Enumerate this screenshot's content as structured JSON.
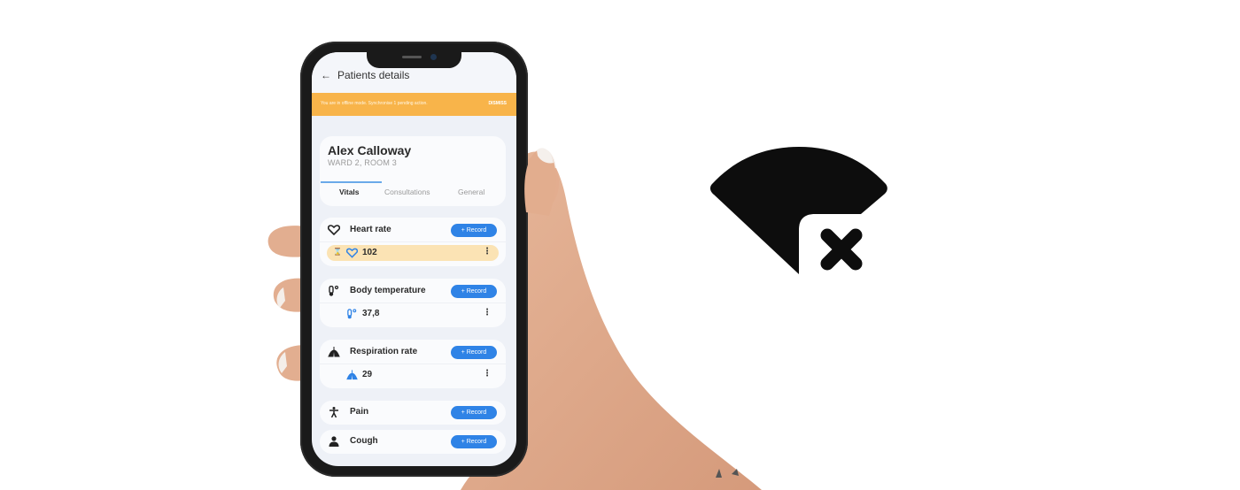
{
  "app": {
    "title": "Patients details",
    "back_icon": "arrow-left-icon"
  },
  "banner": {
    "message": "You are in offline mode. Synchronise 1 pending action.",
    "dismiss_label": "DISMISS",
    "color": "#f8b44a"
  },
  "patient": {
    "name": "Alex Calloway",
    "location": "WARD 2, ROOM 3"
  },
  "tabs": [
    {
      "label": "Vitals",
      "active": true
    },
    {
      "label": "Consultations",
      "active": false
    },
    {
      "label": "General",
      "active": false
    }
  ],
  "vitals": [
    {
      "label": "Heart rate",
      "icon": "heart-icon",
      "record_label": "+ Record",
      "value": "102",
      "value_icon": "heart-icon",
      "pending": true
    },
    {
      "label": "Body temperature",
      "icon": "thermometer-icon",
      "record_label": "+ Record",
      "value": "37,8",
      "value_icon": "thermometer-icon",
      "pending": false
    },
    {
      "label": "Respiration rate",
      "icon": "lungs-icon",
      "record_label": "+ Record",
      "value": "29",
      "value_icon": "lungs-icon",
      "pending": false
    },
    {
      "label": "Pain",
      "icon": "person-icon",
      "record_label": "+ Record"
    },
    {
      "label": "Cough",
      "icon": "user-cough-icon",
      "record_label": "+ Record"
    }
  ],
  "colors": {
    "accent": "#2f83e6",
    "pending_bg": "#fbe3b4",
    "tab_indicator": "#6aa9e9"
  },
  "offline_indicator": {
    "icon": "wifi-off-icon"
  }
}
